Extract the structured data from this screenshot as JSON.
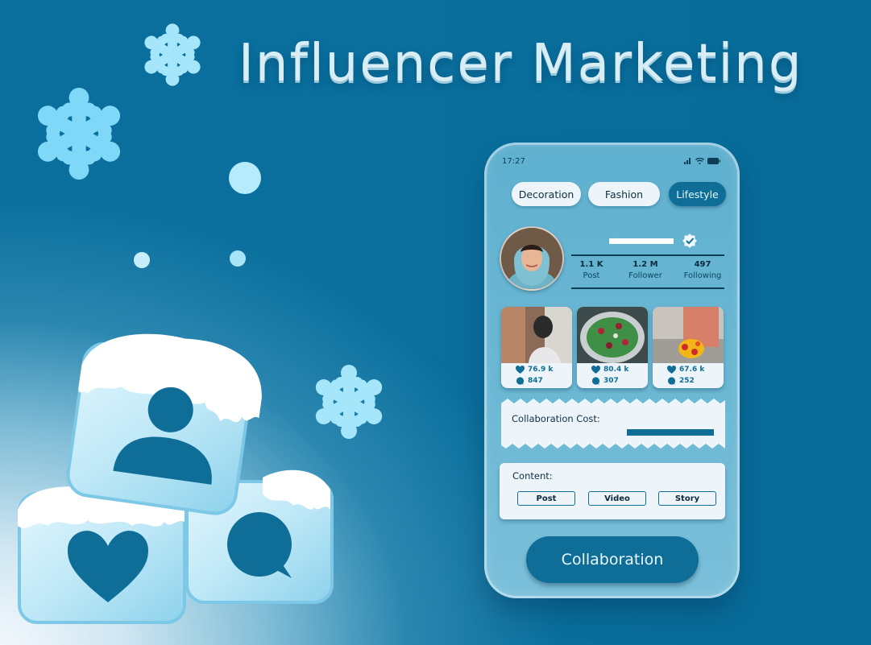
{
  "headline": "Influencer Marketing",
  "phone": {
    "status_time": "17:27",
    "categories": [
      {
        "label": "Decoration",
        "active": false
      },
      {
        "label": "Fashion",
        "active": false
      },
      {
        "label": "Lifestyle",
        "active": true
      }
    ],
    "profile": {
      "verified_icon": "verified-badge-icon",
      "stats": [
        {
          "value": "1.1 K",
          "label": "Post"
        },
        {
          "value": "1.2 M",
          "label": "Follower"
        },
        {
          "value": "497",
          "label": "Following"
        }
      ]
    },
    "posts": [
      {
        "likes": "76.9 k",
        "comments": "847"
      },
      {
        "likes": "80.4 k",
        "comments": "307"
      },
      {
        "likes": "67.6 k",
        "comments": "252"
      }
    ],
    "collaboration_cost_label": "Collaboration Cost:",
    "content_label": "Content:",
    "content_types": [
      "Post",
      "Video",
      "Story"
    ],
    "cta_label": "Collaboration"
  },
  "colors": {
    "accent": "#0e6e98",
    "card_bg": "#eef5fa",
    "phone_bg": "#6ab7d3",
    "ice_light": "#bfe8f7",
    "snowflake": "#9fe3fb"
  },
  "decor_icons": [
    "snowflake-icon",
    "ice-cube-user-icon",
    "ice-cube-heart-icon",
    "ice-cube-chat-icon"
  ]
}
